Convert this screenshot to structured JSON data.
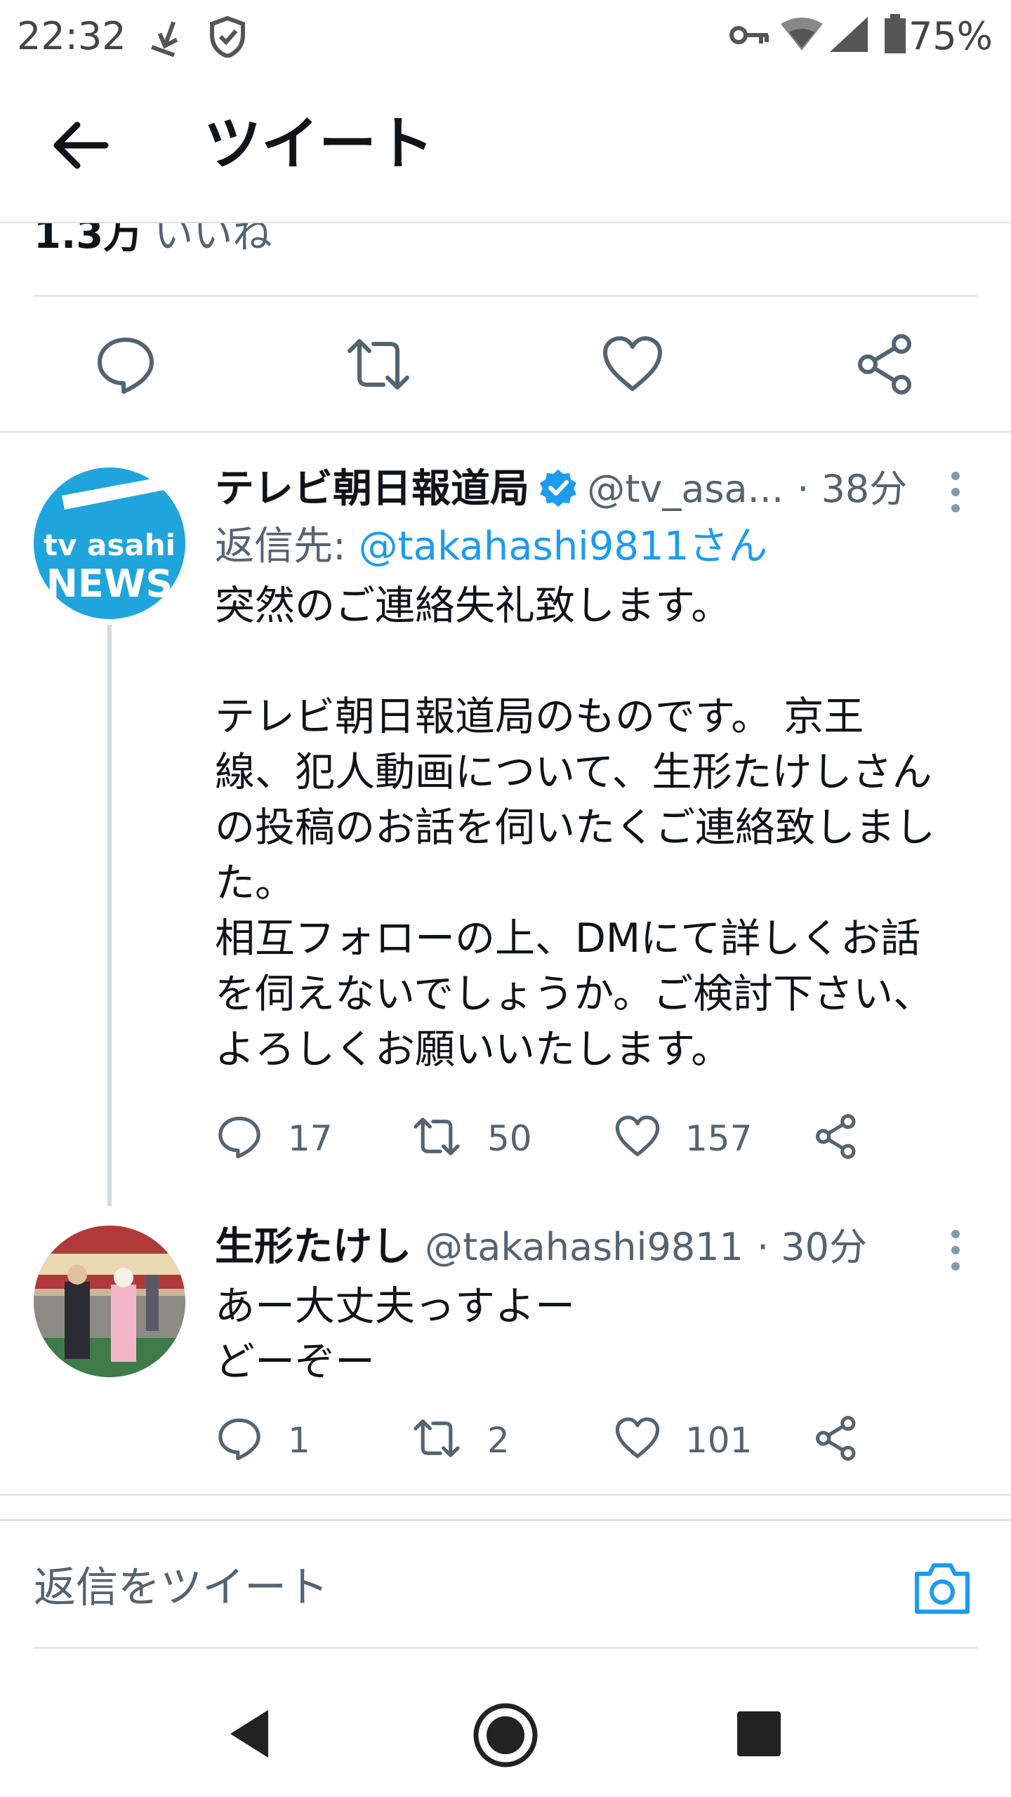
{
  "status_bar": {
    "time": "22:32",
    "battery": "75%"
  },
  "header": {
    "title": "ツイート"
  },
  "likes": {
    "count": "1.3万",
    "label": "いいね"
  },
  "tweets": [
    {
      "name": "テレビ朝日報道局",
      "handle": "@tv_asa...",
      "time": "· 38分",
      "reply_prefix": "返信先: ",
      "reply_to": "@takahashi9811さん",
      "avatar_top": "tv asahi",
      "avatar_bottom": "NEWS",
      "text": "突然のご連絡失礼致します。\n\nテレビ朝日報道局のものです。 京王\n線、犯人動画について、生形たけしさん\nの投稿のお話を伺いたくご連絡致しまし\nた。\n相互フォローの上、DMにて詳しくお話\nを伺えないでしょうか。ご検討下さい、\nよろしくお願いいたします。",
      "replies": "17",
      "retweets": "50",
      "likes": "157"
    },
    {
      "name": "生形たけし",
      "handle": "@takahashi9811",
      "time": "· 30分",
      "text": "あー大丈夫っすよー\nどーぞー",
      "replies": "1",
      "retweets": "2",
      "likes": "101"
    }
  ],
  "compose": {
    "placeholder": "返信をツイート"
  },
  "colors": {
    "accent": "#1d9bf0",
    "text": "#0f1419",
    "secondary": "#536471",
    "divider": "#e1e8ed"
  },
  "icons": [
    "back-arrow-icon",
    "reply-icon",
    "retweet-icon",
    "like-icon",
    "share-icon",
    "verified-badge-icon",
    "more-icon",
    "camera-icon",
    "nav-back-icon",
    "nav-home-icon",
    "nav-recents-icon"
  ]
}
